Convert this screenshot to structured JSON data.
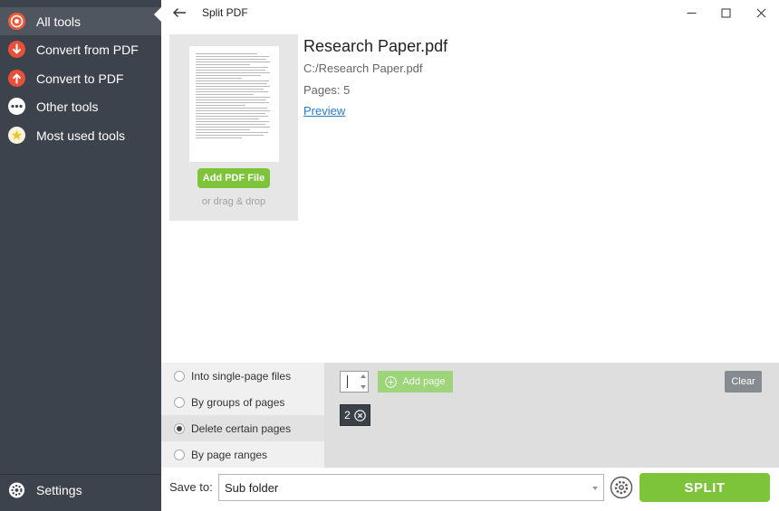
{
  "sidebar": {
    "items": [
      {
        "label": "All tools",
        "icon": "target-icon",
        "color": "#f05a3a",
        "active": true
      },
      {
        "label": "Convert from PDF",
        "icon": "arrow-down-icon",
        "color": "#e8503a"
      },
      {
        "label": "Convert to PDF",
        "icon": "arrow-up-icon",
        "color": "#e8503a"
      },
      {
        "label": "Other tools",
        "icon": "dots-icon",
        "color": "#ffffff"
      },
      {
        "label": "Most used tools",
        "icon": "star-icon",
        "color": "#f3c428"
      }
    ],
    "settings_label": "Settings"
  },
  "window": {
    "title": "Split PDF",
    "controls": [
      "minimize-icon",
      "maximize-icon",
      "close-icon"
    ]
  },
  "file": {
    "add_button": "Add PDF File",
    "drag_hint": "or drag & drop",
    "name": "Research Paper.pdf",
    "path": "C:/Research Paper.pdf",
    "pages": "Pages: 5",
    "preview_link": "Preview"
  },
  "split_options": {
    "items": [
      {
        "label": "Into single-page files",
        "selected": false
      },
      {
        "label": "By groups of pages",
        "selected": false
      },
      {
        "label": "Delete certain pages",
        "selected": true
      },
      {
        "label": "By page ranges",
        "selected": false
      }
    ]
  },
  "config": {
    "page_input_value": "",
    "add_page_label": "Add page",
    "clear_label": "Clear",
    "selected_pages": [
      "2"
    ]
  },
  "bottom": {
    "save_to_label": "Save to:",
    "save_to_value": "Sub folder",
    "split_label": "SPLIT"
  },
  "colors": {
    "sidebar_bg": "#3d434c",
    "accent_green": "#7dc43a",
    "link_blue": "#2a7ac7"
  }
}
